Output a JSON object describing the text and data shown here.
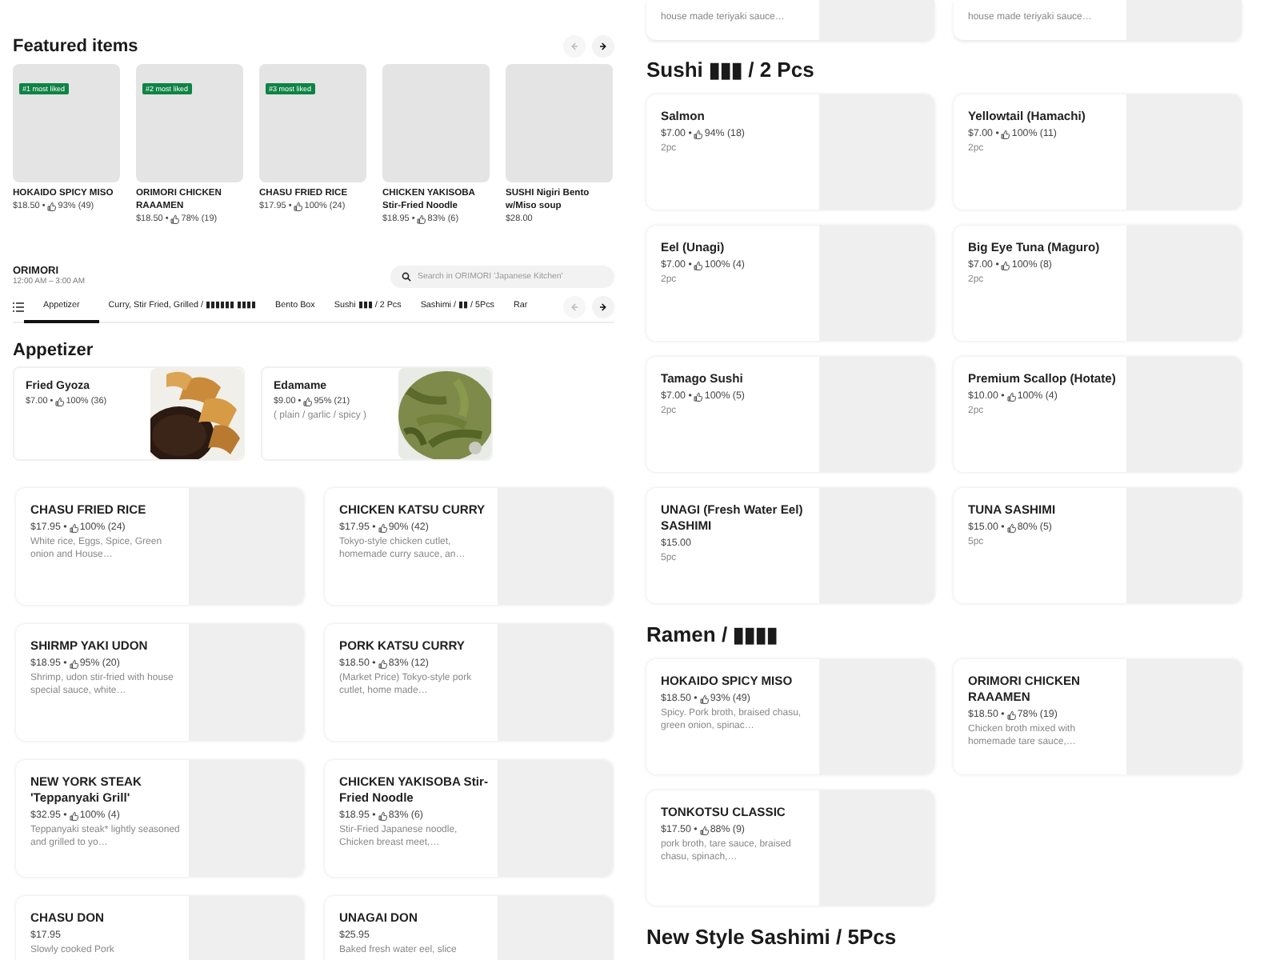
{
  "featured": {
    "title": "Featured items",
    "nav": [
      {
        "kind": "prev",
        "disabled": true
      },
      {
        "kind": "next",
        "disabled": false
      }
    ],
    "items": [
      {
        "badge": "#1 most liked",
        "name": "HOKAIDO SPICY MISO",
        "price": "$18.50 •",
        "rating": "93% (49)"
      },
      {
        "badge": "#2 most liked",
        "name": "ORIMORI CHICKEN RAAAMEN",
        "price": "$18.50 •",
        "rating": "78% (19)"
      },
      {
        "badge": "#3 most liked",
        "name": "CHASU FRIED RICE",
        "price": "$17.95 •",
        "rating": "100% (24)"
      },
      {
        "name": "CHICKEN YAKISOBA Stir-Fried Noodle",
        "price": "$18.95 •",
        "rating": "83% (6)"
      },
      {
        "name": "SUSHI  Nigiri Bento w/Miso soup",
        "price": "$28.00"
      }
    ]
  },
  "store": {
    "name": "ORIMORI",
    "hours": "12:00 AM – 3:00 AM",
    "search_placeholder": "Search in ORIMORI 'Japanese Kitchen'"
  },
  "category_tabs": {
    "tabs": [
      {
        "label": "Appetizer",
        "selected": true
      },
      {
        "label": "Curry, Stir Fried, Grilled / ▮▮▮▮▮▮ ▮▮▮▮",
        "selected": false
      },
      {
        "label": "Bento Box",
        "selected": false
      },
      {
        "label": "Sushi ▮▮▮ / 2 Pcs",
        "selected": false
      },
      {
        "label": "Sashimi / ▮▮ / 5Pcs",
        "selected": false
      },
      {
        "label": "Rar",
        "selected": false
      }
    ],
    "nav": [
      {
        "kind": "prev",
        "disabled": true
      },
      {
        "kind": "next",
        "disabled": false
      }
    ]
  },
  "appetizer": {
    "title": "Appetizer",
    "items": [
      {
        "name": "Fried Gyoza",
        "price": "$7.00 •",
        "rating": "100% (36)"
      },
      {
        "name": "Edamame",
        "price": "$9.00 •",
        "rating": "95% (21)",
        "description": "( plain / garlic / spicy )"
      }
    ]
  },
  "menu_cards": [
    {
      "name": "CHASU FRIED RICE",
      "price": "$17.95 •",
      "rating": "100% (24)",
      "description": "White rice, Eggs, Spice, Green onion and House…"
    },
    {
      "name": "CHICKEN KATSU CURRY",
      "price": "$17.95 •",
      "rating": "90% (42)",
      "description": "Tokyo-style chicken cutlet, homemade curry sauce, an…"
    },
    {
      "name": "SHIRMP YAKI UDON",
      "price": "$18.95 •",
      "rating": "95% (20)",
      "description": "Shrimp, udon stir-fried with house special sauce, white…"
    },
    {
      "name": "PORK KATSU CURRY",
      "price": "$18.50 •",
      "rating": "83% (12)",
      "description": "(Market Price) Tokyo-style pork cutlet, home made…"
    },
    {
      "name": "NEW YORK STEAK 'Teppanyaki Grill'",
      "price": "$32.95 •",
      "rating": "100% (4)",
      "description": "Teppanyaki steak* lightly seasoned and grilled to yo…"
    },
    {
      "name": "CHICKEN YAKISOBA Stir-Fried Noodle",
      "price": "$18.95 •",
      "rating": "83% (6)",
      "description": "Stir-Fried Japanese noodle, Chicken breast meet,…"
    },
    {
      "name": "CHASU DON",
      "price": "$17.95",
      "description": "Slowly cooked Pork"
    },
    {
      "name": "UNAGAI DON",
      "price": "$25.95",
      "description": "Baked fresh water eel, slice"
    }
  ],
  "right_column": {
    "fragments": [
      {
        "description": "house made teriyaki sauce…"
      },
      {
        "description": "house made teriyaki sauce…"
      }
    ],
    "sections": [
      {
        "title": "Sushi ▮▮▮ / 2 Pcs",
        "items": [
          {
            "name": "Salmon",
            "price": "$7.00 •",
            "rating": "94% (18)",
            "description": "2pc"
          },
          {
            "name": "Yellowtail (Hamachi)",
            "price": "$7.00 •",
            "rating": "100% (11)",
            "description": "2pc"
          },
          {
            "name": "Eel (Unagi)",
            "price": "$7.00 •",
            "rating": "100% (4)",
            "description": "2pc"
          },
          {
            "name": "Big Eye Tuna (Maguro)",
            "price": "$7.00 •",
            "rating": "100% (8)",
            "description": "2pc"
          },
          {
            "name": "Tamago Sushi",
            "price": "$7.00 •",
            "rating": "100% (5)",
            "description": "2pc"
          },
          {
            "name": "Premium Scallop (Hotate)",
            "price": "$10.00 •",
            "rating": "100% (4)",
            "description": "2pc"
          },
          {
            "name": "UNAGI  (Fresh Water Eel) SASHIMI",
            "price": "$15.00",
            "description": "5pc"
          },
          {
            "name": "TUNA SASHIMI",
            "price": "$15.00 •",
            "rating": "80% (5)",
            "description": "5pc"
          }
        ]
      },
      {
        "title": "Ramen / ▮▮▮▮",
        "items": [
          {
            "name": "HOKAIDO SPICY MISO",
            "price": "$18.50 •",
            "rating": "93% (49)",
            "description": "Spicy. Pork broth, braised chasu, green onion, spinac…"
          },
          {
            "name": "ORIMORI CHICKEN RAAAMEN",
            "price": "$18.50 •",
            "rating": "78% (19)",
            "description": "Chicken broth mixed with homemade tare sauce,…"
          },
          {
            "name": "TONKOTSU CLASSIC",
            "price": "$17.50 •",
            "rating": "88% (9)",
            "description": "pork broth, tare sauce, braised chasu, spinach,…"
          }
        ]
      },
      {
        "title": "New Style Sashimi / 5Pcs"
      }
    ]
  }
}
